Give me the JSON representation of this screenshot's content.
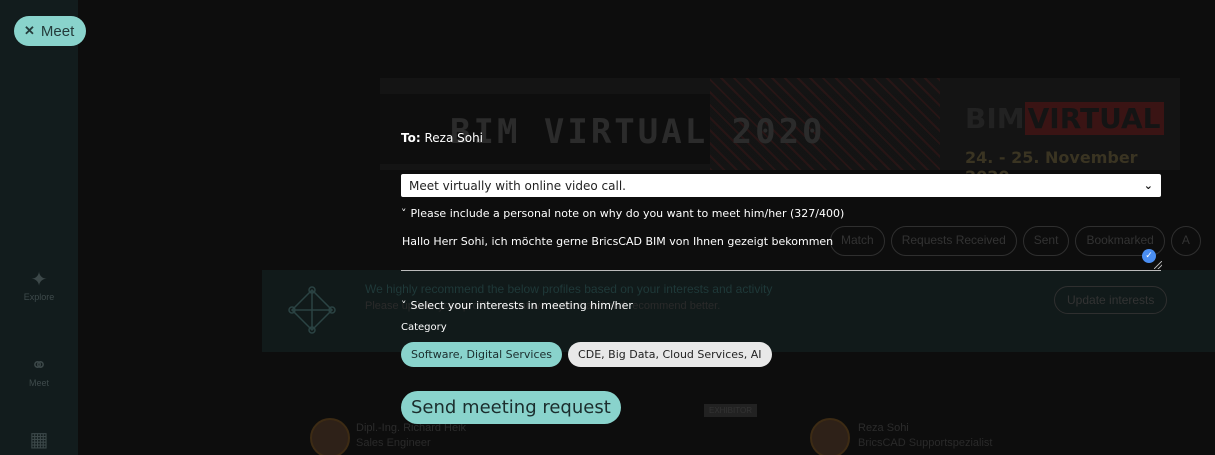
{
  "meet_toggle": {
    "icon": "close-icon",
    "label": "Meet"
  },
  "rail": {
    "items": [
      {
        "icon": "sparkle-icon",
        "label": "Explore"
      },
      {
        "icon": "handshake-icon",
        "label": "Meet"
      },
      {
        "icon": "calendar-icon",
        "label": ""
      }
    ]
  },
  "banner": {
    "title": "BIM VIRTUAL 2020",
    "logo_bim": "BIM",
    "logo_virtual": "VIRTUAL",
    "date": "24. - 25. November 2020"
  },
  "bg_tabs": [
    "Match",
    "Requests Received",
    "Sent",
    "Bookmarked",
    "A"
  ],
  "recommend": {
    "title": "We highly recommend the below profiles based on your interests and activity",
    "subtitle": "Please update your profile so that we understand and recommend better.",
    "update_label": "Update interests"
  },
  "profiles": [
    {
      "name": "Dipl.-Ing. Richard Heik",
      "role": "Sales Engineer",
      "tag": "EXHIBITOR"
    },
    {
      "name": "Reza Sohi",
      "role": "BricsCAD Supportspezialist",
      "tag": ""
    }
  ],
  "form": {
    "to_prefix": "To:",
    "to_name": "Reza Sohi",
    "meeting_type": "Meet virtually with online video call.",
    "note_toggle": "Please include a personal note on why do you want to meet him/her (327/400)",
    "note_text": "Hallo Herr Sohi, ich möchte gerne BricsCAD BIM von Ihnen gezeigt bekommen",
    "interests_toggle": "Select your interests in meeting him/her",
    "category_label": "Category",
    "chips": [
      {
        "label": "Software, Digital Services",
        "selected": true
      },
      {
        "label": "CDE, Big Data, Cloud Services, AI",
        "selected": false
      }
    ],
    "send_label": "Send meeting request"
  },
  "colors": {
    "accent": "#89d3cc",
    "check": "#4a8ef2"
  }
}
